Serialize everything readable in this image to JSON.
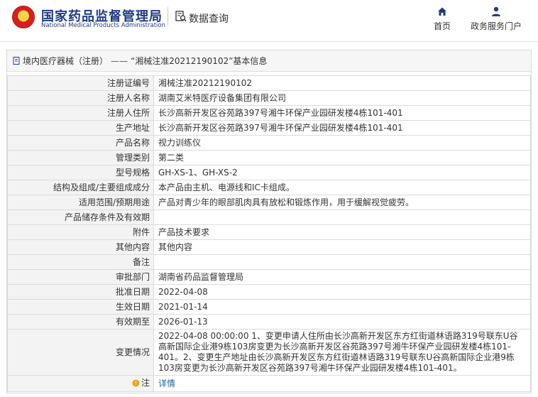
{
  "header": {
    "brand_cn": "国家药品监督管理局",
    "brand_en": "National Medical Products Administration",
    "section": "数据查询",
    "nav": [
      {
        "label": "首页",
        "icon": "home-icon"
      },
      {
        "label": "政务服务门户",
        "icon": "user-icon"
      }
    ]
  },
  "breadcrumb": {
    "category": "境内医疗器械（注册）",
    "separator": "——",
    "title": "“湘械注准20212190102”基本信息"
  },
  "colors": {
    "brand": "#1e3c84",
    "link": "#1f5fa8",
    "label_bg": "#f3f3f3"
  },
  "fields": [
    {
      "label": "注册证编号",
      "value": "湘械注准20212190102"
    },
    {
      "label": "注册人名称",
      "value": "湖南艾米特医疗设备集团有限公司"
    },
    {
      "label": "注册人住所",
      "value": "长沙高新开发区谷苑路397号湘牛环保产业园研发楼4栋101-401"
    },
    {
      "label": "生产地址",
      "value": "长沙高新开发区谷苑路397号湘牛环保产业园研发楼4栋101-401"
    },
    {
      "label": "产品名称",
      "value": "视力训练仪"
    },
    {
      "label": "管理类别",
      "value": "第二类"
    },
    {
      "label": "型号规格",
      "value": "GH-XS-1、GH-XS-2"
    },
    {
      "label": "结构及组成/主要组成成分",
      "value": "本产品由主机、电源线和IC卡组成。"
    },
    {
      "label": "适用范围/预期用途",
      "value": "产品对青少年的眼部肌肉具有放松和锻炼作用，用于缓解视觉疲劳。"
    },
    {
      "label": "产品储存条件及有效期",
      "value": ""
    },
    {
      "label": "附件",
      "value": "产品技术要求"
    },
    {
      "label": "其他内容",
      "value": "其他内容"
    },
    {
      "label": "备注",
      "value": ""
    },
    {
      "label": "审批部门",
      "value": "湖南省药品监督管理局"
    },
    {
      "label": "批准日期",
      "value": "2022-04-08"
    },
    {
      "label": "生效日期",
      "value": "2021-01-14"
    },
    {
      "label": "有效期至",
      "value": "2026-01-13"
    }
  ],
  "change": {
    "label": "变更情况",
    "value": "2022-04-08 00:00:00 1、变更申请人住所由长沙高新开发区东方红街道林语路319号联东U谷高新国际企业港9栋103房变更为长沙高新开发区谷苑路397号湘牛环保产业园研发楼4栋101-401。2、变更生产地址由长沙高新开发区东方红街道林语路319号联东U谷高新国际企业港9栋103房变更为长沙高新开发区谷苑路397号湘牛环保产业园研发楼4栋101-401。"
  },
  "note": {
    "label": "注",
    "link": "详情"
  }
}
